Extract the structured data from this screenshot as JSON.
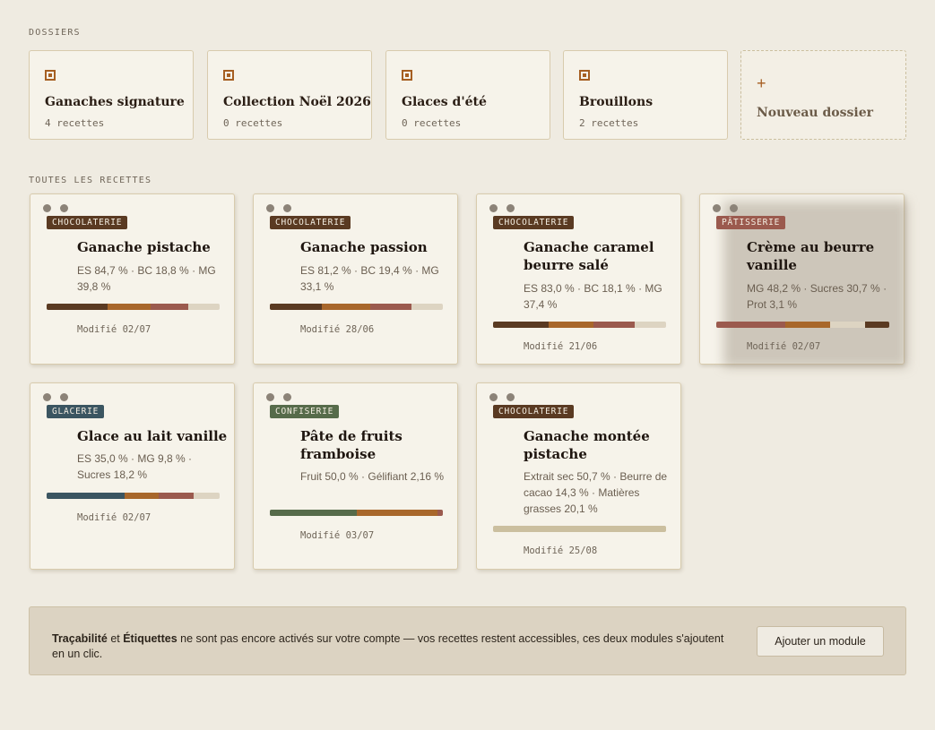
{
  "sections": {
    "folders_label": "DOSSIERS",
    "recipes_label": "TOUTES LES RECETTES"
  },
  "folders": [
    {
      "name": "Ganaches signature",
      "count": "4 recettes",
      "icon": "folder-icon"
    },
    {
      "name": "Collection Noël 2026",
      "count": "0 recettes",
      "icon": "folder-icon"
    },
    {
      "name": "Glaces d'été",
      "count": "0 recettes",
      "icon": "folder-icon"
    },
    {
      "name": "Brouillons",
      "count": "2 recettes",
      "icon": "folder-icon"
    }
  ],
  "new_folder": {
    "plus": "+",
    "label": "Nouveau dossier",
    "icon": "plus-icon"
  },
  "colors": {
    "accent": "#a65f22",
    "chocolaterie": "#5a3a22",
    "patisserie": "#9b5a4e",
    "glacerie": "#3b5561",
    "confiserie": "#566b4a"
  },
  "recipes": [
    {
      "category": "CHOCOLATERIE",
      "title": "Ganache pistache",
      "specs": "ES 84,7 % · BC 18,8 % · MG 39,8 %",
      "modified": "Modifié 02/07",
      "bar": [
        {
          "color": "#5a3a22",
          "share": 0.35
        },
        {
          "color": "#a8672b",
          "share": 0.25
        },
        {
          "color": "#9b5a4e",
          "share": 0.22
        }
      ]
    },
    {
      "category": "CHOCOLATERIE",
      "title": "Ganache passion",
      "specs": "ES 81,2 % · BC 19,4 % · MG 33,1 %",
      "modified": "Modifié 28/06",
      "bar": [
        {
          "color": "#5a3a22",
          "share": 0.3
        },
        {
          "color": "#a8672b",
          "share": 0.28
        },
        {
          "color": "#9b5a4e",
          "share": 0.24
        }
      ]
    },
    {
      "category": "CHOCOLATERIE",
      "title": "Ganache caramel beurre salé",
      "specs": "ES 83,0 % · BC 18,1 % · MG 37,4 %",
      "modified": "Modifié 21/06",
      "bar": [
        {
          "color": "#5a3a22",
          "share": 0.32
        },
        {
          "color": "#a8672b",
          "share": 0.26
        },
        {
          "color": "#9b5a4e",
          "share": 0.24
        }
      ]
    },
    {
      "category": "PÂTISSERIE",
      "title": "Crème au beurre vanille",
      "specs": "MG 48,2 % · Sucres 30,7 % · Prot 3,1 %",
      "modified": "Modifié 02/07",
      "bar": [
        {
          "color": "#9b5a4e",
          "share": 0.4
        },
        {
          "color": "#a8672b",
          "share": 0.26
        },
        {
          "color": "#ddd4c2",
          "share": 0.2
        },
        {
          "color": "#5a3a22",
          "share": 0.14
        }
      ]
    },
    {
      "category": "GLACERIE",
      "title": "Glace au lait vanille",
      "specs": "ES 35,0 % · MG 9,8 % · Sucres 18,2 %",
      "modified": "Modifié 02/07",
      "bar": [
        {
          "color": "#3b5561",
          "share": 0.45
        },
        {
          "color": "#a8672b",
          "share": 0.2
        },
        {
          "color": "#9b5a4e",
          "share": 0.2
        }
      ]
    },
    {
      "category": "CONFISERIE",
      "title": "Pâte de fruits framboise",
      "specs": "Fruit 50,0 % · Gélifiant 2,16 %",
      "modified": "Modifié 03/07",
      "bar": [
        {
          "color": "#566b4a",
          "share": 0.5
        },
        {
          "color": "#a8672b",
          "share": 0.47
        },
        {
          "color": "#9b5a4e",
          "share": 0.03
        }
      ]
    },
    {
      "category": "CHOCOLATERIE",
      "title": "Ganache montée pistache",
      "specs": "Extrait sec 50,7 % · Beurre de cacao 14,3 % · Matières grasses 20,1 %",
      "modified": "Modifié 25/08",
      "bar": [
        {
          "color": "#cbbf9f",
          "share": 1.0
        }
      ]
    }
  ],
  "banner": {
    "strong1": "Traçabilité",
    "text1": " et ",
    "strong2": "Étiquettes",
    "text2": " ne sont pas encore activés sur votre compte — vos recettes restent accessibles, ces deux modules s'ajoutent en un clic.",
    "button": "Ajouter un module"
  }
}
